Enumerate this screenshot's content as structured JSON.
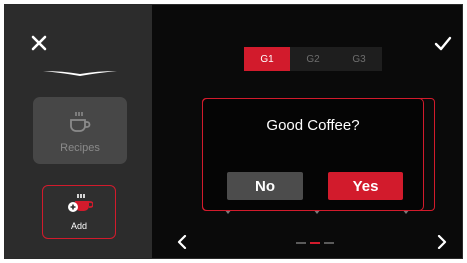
{
  "sidebar": {
    "recipes_label": "Recipes",
    "add_label": "Add"
  },
  "grinder_tabs": [
    {
      "label": "G1",
      "active": true
    },
    {
      "label": "G2",
      "active": false
    },
    {
      "label": "G3",
      "active": false
    }
  ],
  "dialog": {
    "question": "Good Coffee?",
    "no_label": "No",
    "yes_label": "Yes"
  },
  "pager": {
    "pages": 3,
    "active_index": 1
  },
  "colors": {
    "accent": "#d21b2c",
    "background": "#0a0a0a",
    "sidebar": "#2c2c2c",
    "disabled_card": "#474747"
  },
  "icons": {
    "close": "close-icon",
    "confirm": "checkmark-icon",
    "recipes": "coffee-cup-icon",
    "add": "add-coffee-icon",
    "prev": "chevron-left-icon",
    "next": "chevron-right-icon"
  }
}
